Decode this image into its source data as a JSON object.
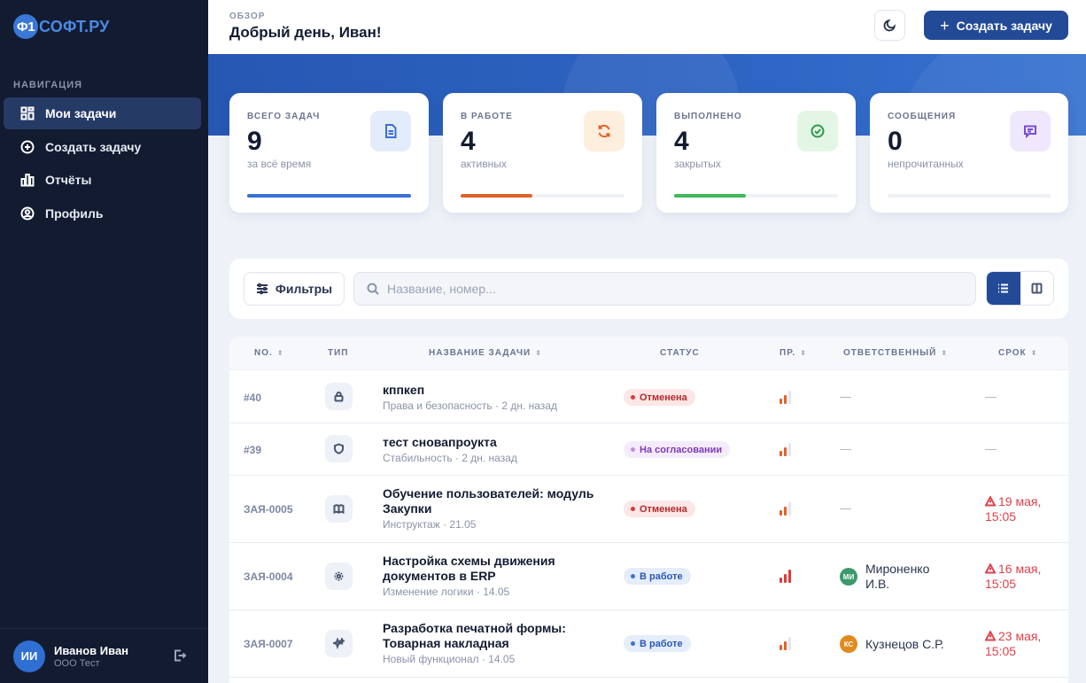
{
  "brand": {
    "badge": "Ф1",
    "name": "СОФТ.РУ"
  },
  "sidebar": {
    "section_title": "НАВИГАЦИЯ",
    "items": [
      {
        "label": "Мои задачи",
        "icon": "grid-icon",
        "active": true
      },
      {
        "label": "Создать задачу",
        "icon": "plus-circle-icon",
        "active": false
      },
      {
        "label": "Отчёты",
        "icon": "bar-chart-icon",
        "active": false
      },
      {
        "label": "Профиль",
        "icon": "user-circle-icon",
        "active": false
      }
    ],
    "user": {
      "initials": "ИИ",
      "name": "Иванов Иван",
      "org": "ООО Тест"
    }
  },
  "header": {
    "breadcrumb": "ОБЗОР",
    "greeting": "Добрый день, Иван!",
    "create_button": "Создать задачу"
  },
  "stats": [
    {
      "label": "ВСЕГО ЗАДАЧ",
      "value": "9",
      "sub": "за всё время",
      "icon": "document-icon",
      "progress": 1.0,
      "color": "#3a6fd8",
      "icon_bg": "#e3ecfb",
      "icon_color": "#3a6fd8"
    },
    {
      "label": "В РАБОТЕ",
      "value": "4",
      "sub": "активных",
      "icon": "refresh-icon",
      "progress": 0.44,
      "color": "#e0622a",
      "icon_bg": "#fdeedd",
      "icon_color": "#e0622a"
    },
    {
      "label": "ВЫПОЛНЕНО",
      "value": "4",
      "sub": "закрытых",
      "icon": "check-circle-icon",
      "progress": 0.44,
      "color": "#3fb85a",
      "icon_bg": "#e3f6e6",
      "icon_color": "#2f9a47"
    },
    {
      "label": "СООБЩЕНИЯ",
      "value": "0",
      "sub": "непрочитанных",
      "icon": "message-icon",
      "progress": 0,
      "color": "#8a5ae0",
      "icon_bg": "#efe8fc",
      "icon_color": "#7c4ad6"
    }
  ],
  "filters": {
    "button_label": "Фильтры",
    "search_placeholder": "Название, номер..."
  },
  "table": {
    "columns": [
      "NO.",
      "ТИП",
      "НАЗВАНИЕ ЗАДАЧИ",
      "СТАТУС",
      "ПР.",
      "ОТВЕТСТВЕННЫЙ",
      "СРОК"
    ],
    "rows": [
      {
        "no": "#40",
        "type_icon": "lock-icon",
        "title": "кппкеп",
        "meta": "Права и безопасность · 2 дн. назад",
        "status": "Отменена",
        "status_kind": "cancel",
        "priority_level": 2,
        "assignee": "—",
        "due": "—"
      },
      {
        "no": "#39",
        "type_icon": "shield-icon",
        "title": "тест сновапроукта",
        "meta": "Стабильность · 2 дн. назад",
        "status": "На согласовании",
        "status_kind": "review",
        "priority_level": 2,
        "assignee": "—",
        "due": "—"
      },
      {
        "no": "ЗАЯ-0005",
        "type_icon": "book-icon",
        "title": "Обучение пользователей: модуль Закупки",
        "meta": "Инструктаж · 21.05",
        "status": "Отменена",
        "status_kind": "cancel",
        "priority_level": 2,
        "assignee": "—",
        "due": "19 мая, 15:05"
      },
      {
        "no": "ЗАЯ-0004",
        "type_icon": "gear-icon",
        "title": "Настройка схемы движения документов в ERP",
        "meta": "Изменение логики · 14.05",
        "status": "В работе",
        "status_kind": "work",
        "priority_level": 3,
        "assignee_initials": "МИ",
        "assignee": "Мироненко И.В.",
        "assignee_color": "#3a9a6a",
        "due": "16 мая, 15:05"
      },
      {
        "no": "ЗАЯ-0007",
        "type_icon": "sparkle-icon",
        "title": "Разработка печатной формы: Товарная накладная",
        "meta": "Новый функционал · 14.05",
        "status": "В работе",
        "status_kind": "work",
        "priority_level": 2,
        "assignee_initials": "КС",
        "assignee": "Кузнецов С.Р.",
        "assignee_color": "#e08a1e",
        "due": "23 мая, 15:05"
      }
    ]
  }
}
